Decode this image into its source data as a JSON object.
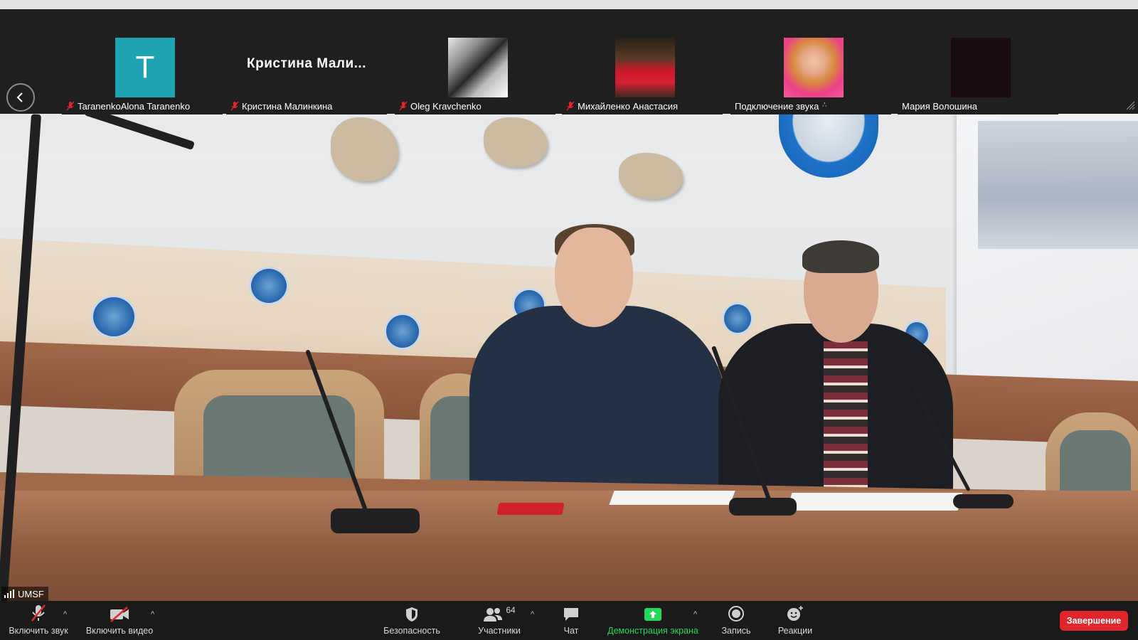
{
  "participants": [
    {
      "name": "TaranenkoAlona Taranenko",
      "initial": "T",
      "muted": true,
      "thumb": "initial",
      "color": "#1ea3b0"
    },
    {
      "name": "Кристина Малинкина",
      "display_name": "Кристина  Мали...",
      "muted": true,
      "thumb": "name"
    },
    {
      "name": "Oleg Kravchenko",
      "muted": true,
      "thumb": "photo"
    },
    {
      "name": "Михайленко Анастасия",
      "muted": true,
      "thumb": "photo"
    },
    {
      "name": "Подключение звука",
      "muted": false,
      "thumb": "photo",
      "connecting": true
    },
    {
      "name": "Мария Волошина",
      "muted": false,
      "thumb": "dark"
    }
  ],
  "active_speaker": {
    "label": "UMSF"
  },
  "toolbar": {
    "unmute_label": "Включить звук",
    "video_label": "Включить видео",
    "security_label": "Безопасность",
    "participants_label": "Участники",
    "participants_count": "64",
    "chat_label": "Чат",
    "share_label": "Демонстрация экрана",
    "record_label": "Запись",
    "reactions_label": "Реакции",
    "end_label": "Завершение"
  },
  "colors": {
    "share_green": "#23d959",
    "end_red": "#e0262c",
    "initial_teal": "#1ea3b0"
  }
}
